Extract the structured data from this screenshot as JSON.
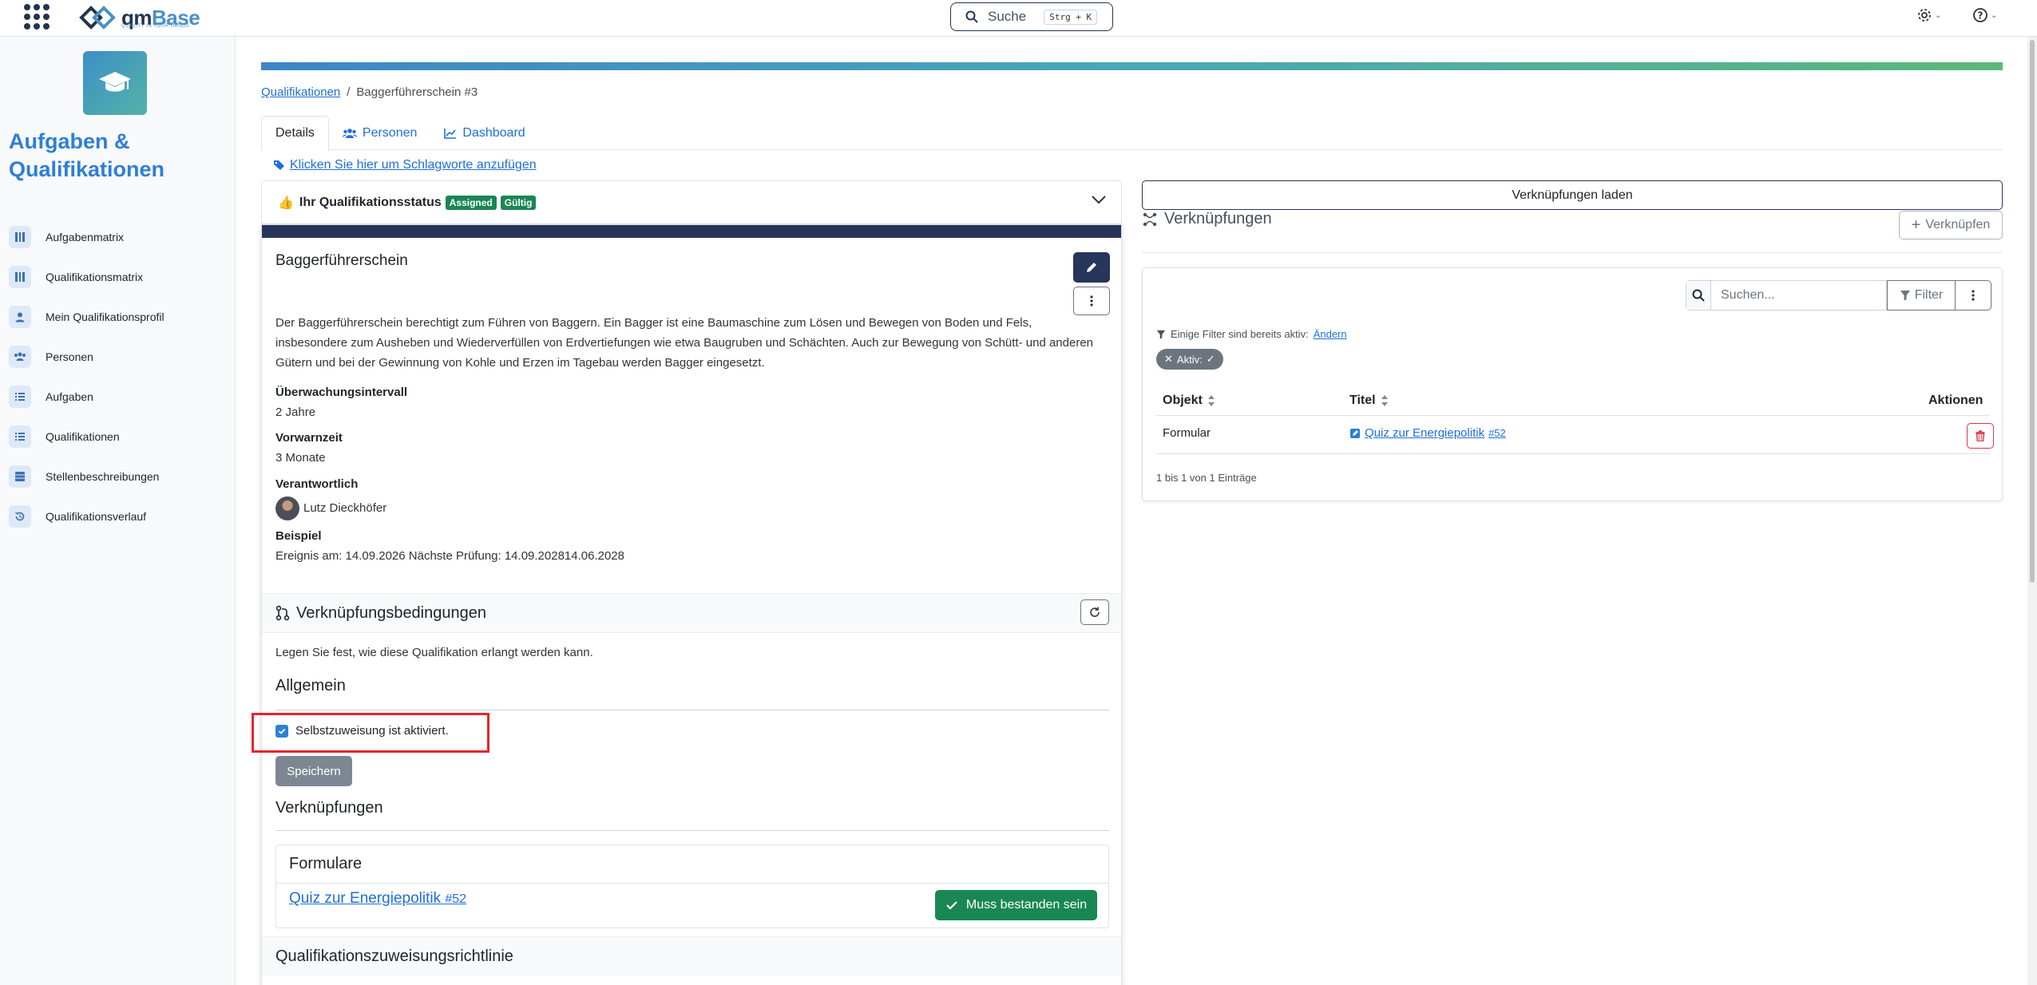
{
  "topbar": {
    "logo_text_a": "qm",
    "logo_text_b": "Base",
    "logo_tagline": "QUALITY IN YOUR HANDS",
    "search_label": "Suche",
    "search_shortcut": "Strg + K"
  },
  "sidebar": {
    "module_title": "Aufgaben & Qualifikationen",
    "items": [
      {
        "label": "Aufgabenmatrix",
        "icon": "matrix-icon"
      },
      {
        "label": "Qualifikationsmatrix",
        "icon": "matrix-icon"
      },
      {
        "label": "Mein Qualifikationsprofil",
        "icon": "user-icon"
      },
      {
        "label": "Personen",
        "icon": "users-icon"
      },
      {
        "label": "Aufgaben",
        "icon": "list-icon"
      },
      {
        "label": "Qualifikationen",
        "icon": "list-icon"
      },
      {
        "label": "Stellenbeschreibungen",
        "icon": "table-icon"
      },
      {
        "label": "Qualifikationsverlauf",
        "icon": "history-icon"
      }
    ]
  },
  "breadcrumb": {
    "parent": "Qualifikationen",
    "separator": "/",
    "current": "Baggerführerschein #3"
  },
  "tabs": [
    {
      "label": "Details"
    },
    {
      "label": "Personen"
    },
    {
      "label": "Dashboard"
    }
  ],
  "tags_link": "Klicken Sie hier um Schlagworte anzufügen",
  "status": {
    "label": "Ihr Qualifikationsstatus",
    "badge_assigned": "Assigned",
    "badge_valid": "Gültig"
  },
  "qualification": {
    "title": "Baggerführerschein",
    "description": "Der Baggerführerschein berechtigt zum Führen von Baggern. Ein Bagger ist eine Baumaschine zum Lösen und Bewegen von Boden und Fels, insbesondere zum Ausheben und Wiederverfüllen von Erdvertiefungen wie etwa Baugruben und Schächten. Auch zur Bewegung von Schütt- und anderen Gütern und bei der Gewinnung von Kohle und Erzen im Tagebau werden Bagger eingesetzt.",
    "interval_label": "Überwachungsintervall",
    "interval_value": "2 Jahre",
    "warning_label": "Vorwarnzeit",
    "warning_value": "3 Monate",
    "responsible_label": "Verantwortlich",
    "responsible_value": "Lutz Dieckhöfer",
    "example_label": "Beispiel",
    "example_value": "Ereignis am: 14.09.2026 Nächste Prüfung: 14.09.202814.06.2028"
  },
  "conditions": {
    "title": "Verknüpfungsbedingungen",
    "intro": "Legen Sie fest, wie diese Qualifikation erlangt werden kann.",
    "general_title": "Allgemein",
    "self_assign_label": "Selbstzuweisung ist aktiviert.",
    "self_assign_checked": true,
    "save_label": "Speichern",
    "links_title": "Verknüpfungen",
    "forms_title": "Formulare",
    "form_link": "Quiz zur Energiepolitik",
    "form_number": "#52",
    "must_pass_label": "Muss bestanden sein",
    "assignment_title": "Qualifikationszuweisungsrichtlinie"
  },
  "right": {
    "load_label": "Verknüpfungen laden",
    "title": "Verknüpfungen",
    "link_button": "Verknüpfen",
    "search_placeholder": "Suchen...",
    "filter_label": "Filter",
    "filter_note": "Einige Filter sind bereits aktiv:",
    "filter_change": "Ändern",
    "active_chip": "Aktiv:",
    "columns": [
      "Objekt",
      "Titel",
      "Aktionen"
    ],
    "rows": [
      {
        "object": "Formular",
        "title": "Quiz zur Energiepolitik",
        "number": "#52"
      }
    ],
    "footer": "1 bis 1 von 1 Einträge"
  },
  "colors": {
    "accent": "#2d7fd6",
    "navy": "#263559",
    "success": "#198754",
    "danger": "#dc3545",
    "highlight": "#e3262b"
  }
}
